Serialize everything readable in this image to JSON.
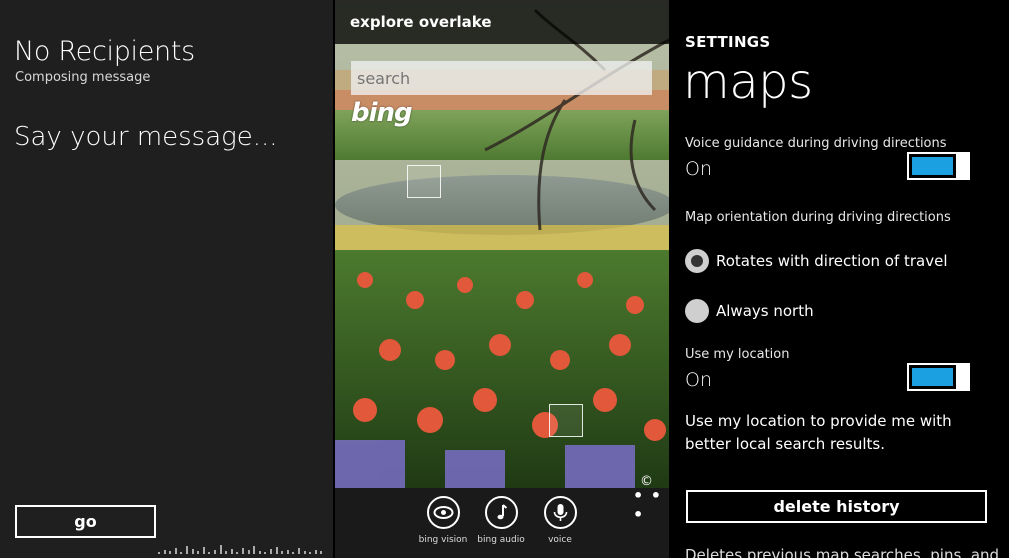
{
  "messaging": {
    "title": "No Recipients",
    "subtitle": "Composing message",
    "prompt": "Say your message...",
    "go_label": "go"
  },
  "bing": {
    "header": "explore overlake",
    "search_placeholder": "search",
    "logo_text": "bing",
    "copyright": "©",
    "more": "• • •",
    "buttons": [
      {
        "label": "bing vision",
        "icon": "eye-icon"
      },
      {
        "label": "bing audio",
        "icon": "music-note-icon"
      },
      {
        "label": "voice",
        "icon": "microphone-icon"
      }
    ]
  },
  "settings": {
    "category": "SETTINGS",
    "title": "maps",
    "voice_guidance_label": "Voice guidance during driving directions",
    "voice_guidance_value": "On",
    "orientation_label": "Map orientation during driving directions",
    "orientation_options": [
      {
        "label": "Rotates with direction of travel",
        "selected": true
      },
      {
        "label": "Always north",
        "selected": false
      }
    ],
    "location_label": "Use my location",
    "location_value": "On",
    "location_description": "Use my location to provide me with better local search results.",
    "delete_label": "delete history",
    "delete_description_partial": "Deletes previous map searches, pins, and"
  },
  "colors": {
    "accent": "#1ba1e2",
    "panel_dark": "#1f1f1f",
    "background": "#000000"
  }
}
